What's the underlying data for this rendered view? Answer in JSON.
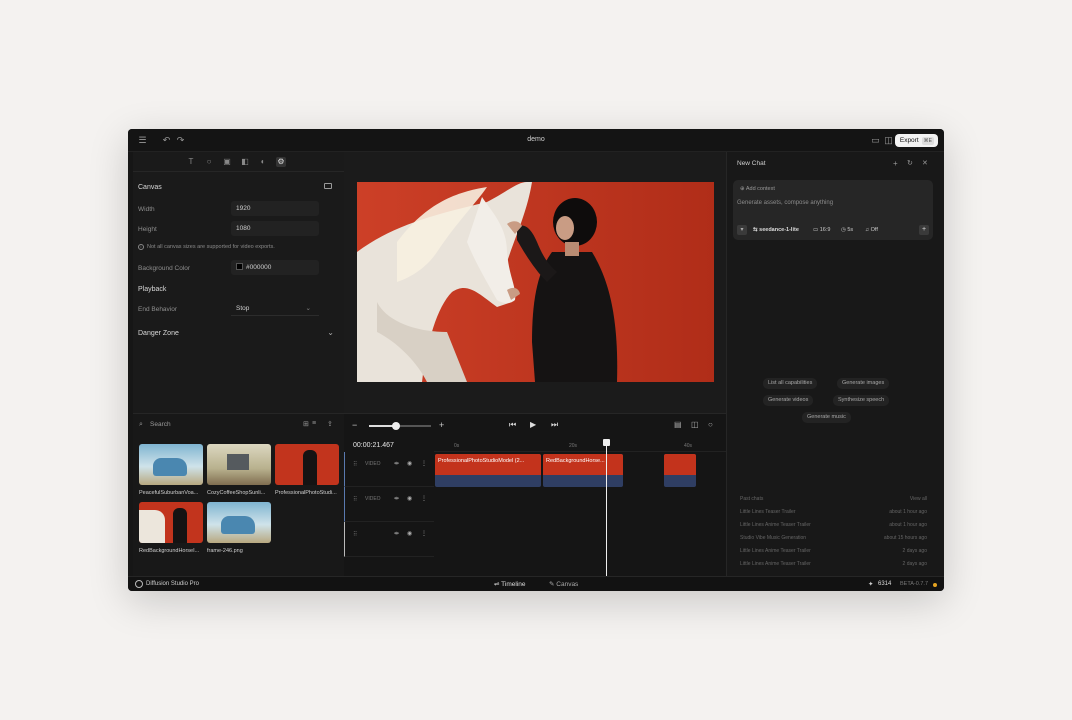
{
  "app": {
    "title": "demo",
    "export_label": "Export",
    "export_shortcut": "⌘E"
  },
  "canvas_panel": {
    "section_title": "Canvas",
    "width_label": "Width",
    "width_value": "1920",
    "height_label": "Height",
    "height_value": "1080",
    "note": "Not all canvas sizes are supported for video exports.",
    "bg_label": "Background Color",
    "bg_value": "#000000",
    "playback_title": "Playback",
    "end_behavior_label": "End Behavior",
    "end_behavior_value": "Stop",
    "danger_title": "Danger Zone"
  },
  "library": {
    "search_placeholder": "Search",
    "items": [
      {
        "label": "PeacefulSuburbanVoa..."
      },
      {
        "label": "CozyCoffeeShopSunli..."
      },
      {
        "label": "ProfessionalPhotoStudi..."
      },
      {
        "label": "RedBackgroundHorseI..."
      },
      {
        "label": "frame-246.png"
      }
    ]
  },
  "timeline": {
    "timecode": "00:00:21.467",
    "ruler": [
      "0s",
      "20s",
      "40s"
    ],
    "tracks": [
      {
        "label": "VIDEO"
      },
      {
        "label": "VIDEO"
      },
      {
        "label": ""
      }
    ],
    "clips": [
      {
        "label": "ProfessionalPhotoStudioModel (2..."
      },
      {
        "label": "RedBackgroundHorse..."
      },
      {
        "label": ""
      }
    ]
  },
  "chat": {
    "title": "New Chat",
    "add_context": "Add context",
    "placeholder": "Generate assets, compose anything",
    "model": "seedance-1-lite",
    "ratio": "16:9",
    "duration": "5s",
    "audio": "Off",
    "suggestions": [
      "List all capabilities",
      "Generate images",
      "Generate videos",
      "Synthesize speech",
      "Generate music"
    ],
    "past_title": "Past chats",
    "view_all": "View all",
    "past": [
      {
        "title": "Little Lines Teaser Trailer",
        "ago": "about 1 hour ago"
      },
      {
        "title": "Little Lines Anime Teaser Trailer",
        "ago": "about 1 hour ago"
      },
      {
        "title": "Studio Vibe Music Generation",
        "ago": "about 15 hours ago"
      },
      {
        "title": "Little Lines Anime Teaser Trailer",
        "ago": "2 days ago"
      },
      {
        "title": "Little Lines Anime Teaser Trailer",
        "ago": "2 days ago"
      }
    ]
  },
  "status": {
    "brand": "Diffusion Studio Pro",
    "tab_timeline": "Timeline",
    "tab_canvas": "Canvas",
    "credits": "6314",
    "version": "BETA-0.7.7"
  }
}
